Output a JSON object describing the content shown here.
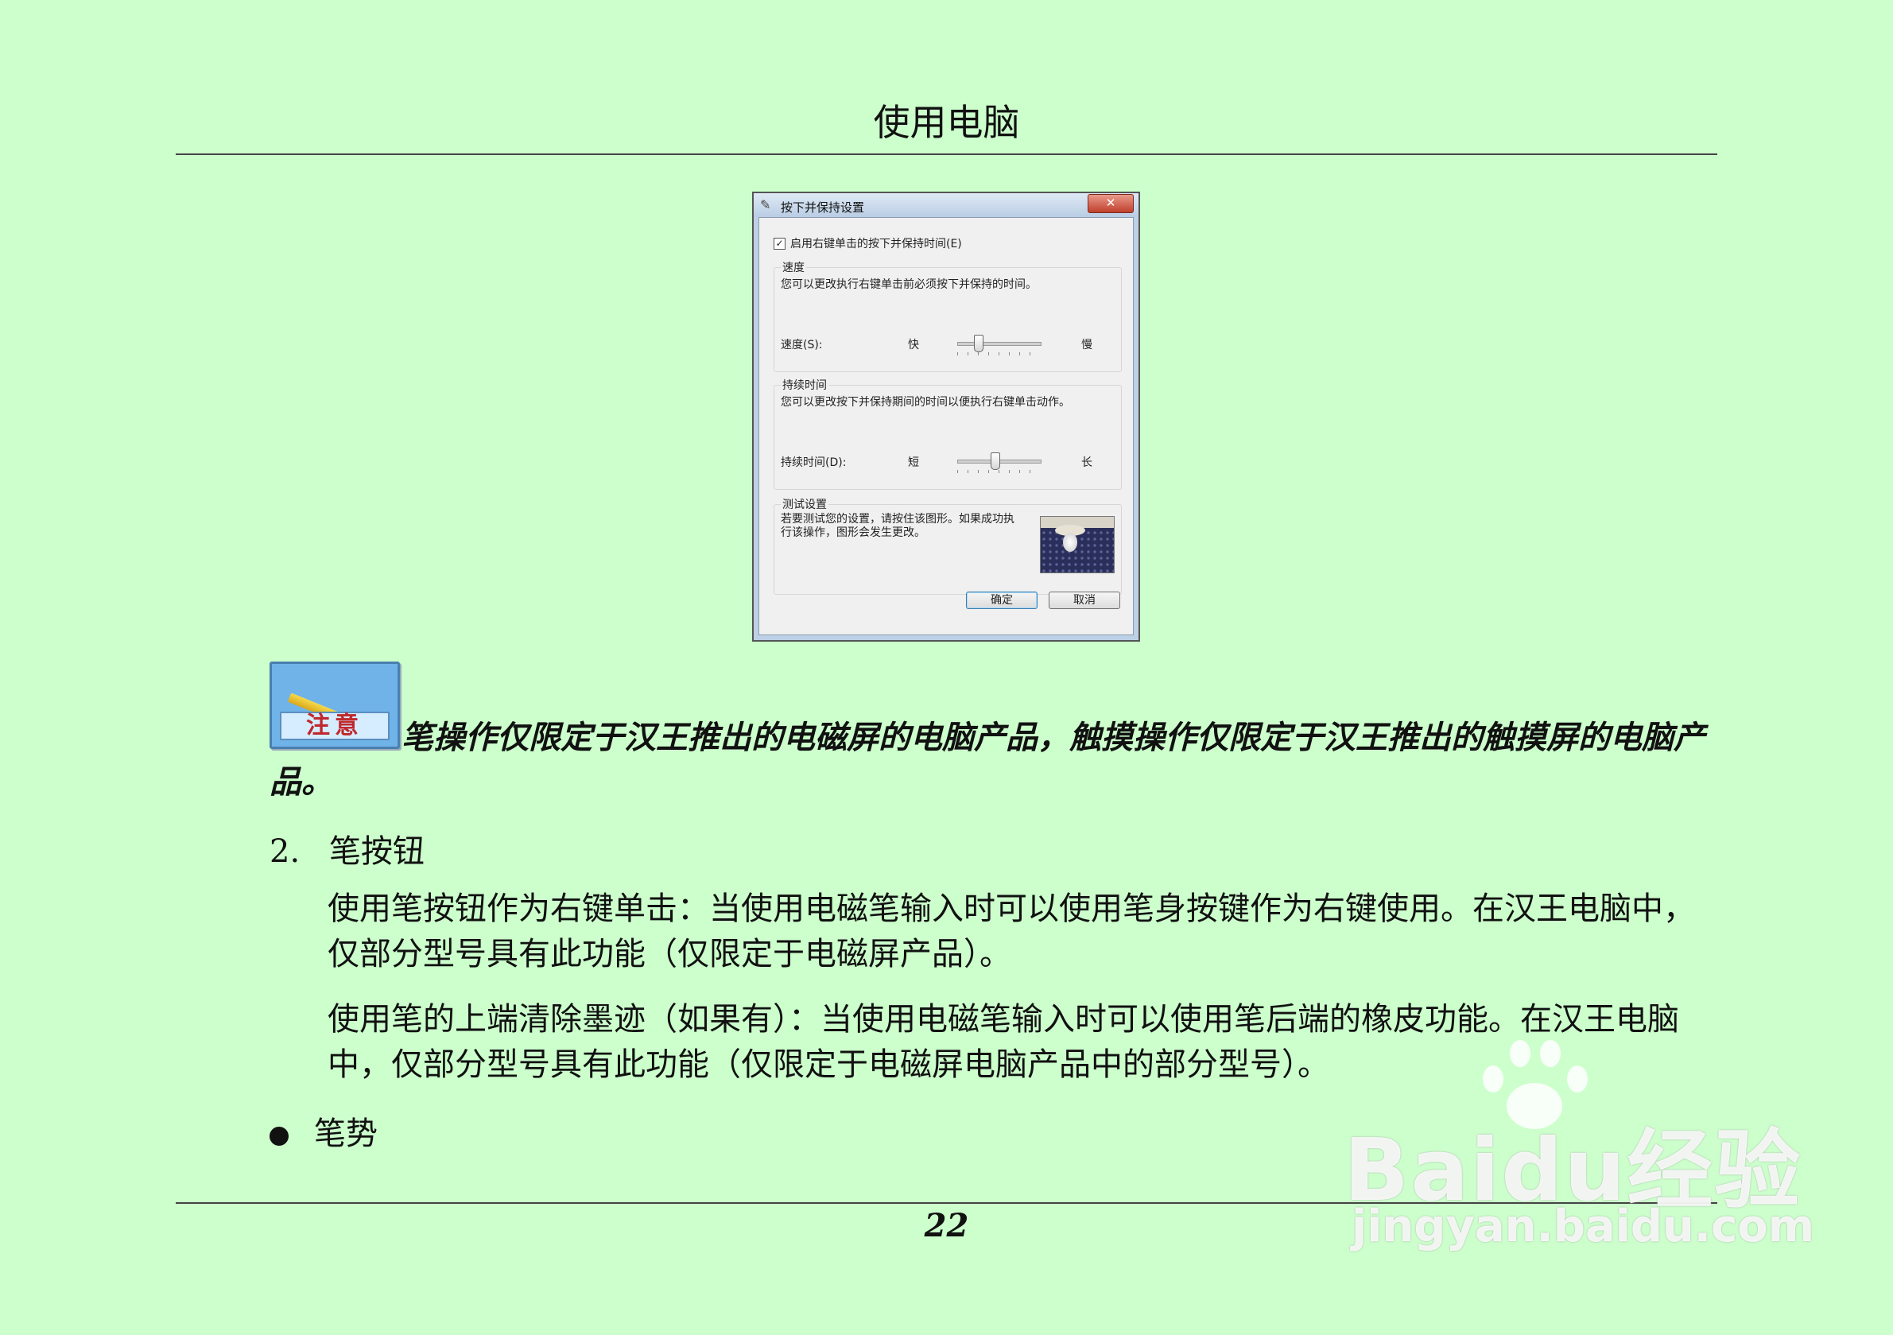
{
  "page": {
    "header": "使用电脑",
    "page_number": "22"
  },
  "dialog": {
    "title": "按下并保持设置",
    "close_label": "✕",
    "enable_checkbox_label": "启用右键单击的按下并保持时间(E)",
    "enable_checked": true,
    "speed_group": {
      "title": "速度",
      "description": "您可以更改执行右键单击前必须按下并保持的时间。",
      "slider_label": "速度(S):",
      "min_label": "快",
      "max_label": "慢",
      "value_fraction": 0.25
    },
    "duration_group": {
      "title": "持续时间",
      "description": "您可以更改按下并保持期间的时间以便执行右键单击动作。",
      "slider_label": "持续时间(D):",
      "min_label": "短",
      "max_label": "长",
      "value_fraction": 0.45
    },
    "test_group": {
      "title": "测试设置",
      "description": "若要测试您的设置，请按住该图形。如果成功执行该操作，图形会发生更改。"
    },
    "ok_label": "确定",
    "cancel_label": "取消"
  },
  "note": {
    "icon_label": "注意",
    "text": "笔操作仅限定于汉王推出的电磁屏的电脑产品，触摸操作仅限定于汉王推出的触摸屏的电脑产品。"
  },
  "section": {
    "number": "2.",
    "title": "笔按钮",
    "paragraphs": [
      "使用笔按钮作为右键单击：当使用电磁笔输入时可以使用笔身按键作为右键使用。在汉王电脑中，仅部分型号具有此功能（仅限定于电磁屏产品）。",
      "使用笔的上端清除墨迹（如果有）：当使用电磁笔输入时可以使用笔后端的橡皮功能。在汉王电脑中，仅部分型号具有此功能（仅限定于电磁屏电脑产品中的部分型号）。"
    ]
  },
  "bullet": {
    "text": "笔势"
  },
  "watermark": {
    "logo": "Baidu经验",
    "url": "jingyan.baidu.com"
  }
}
